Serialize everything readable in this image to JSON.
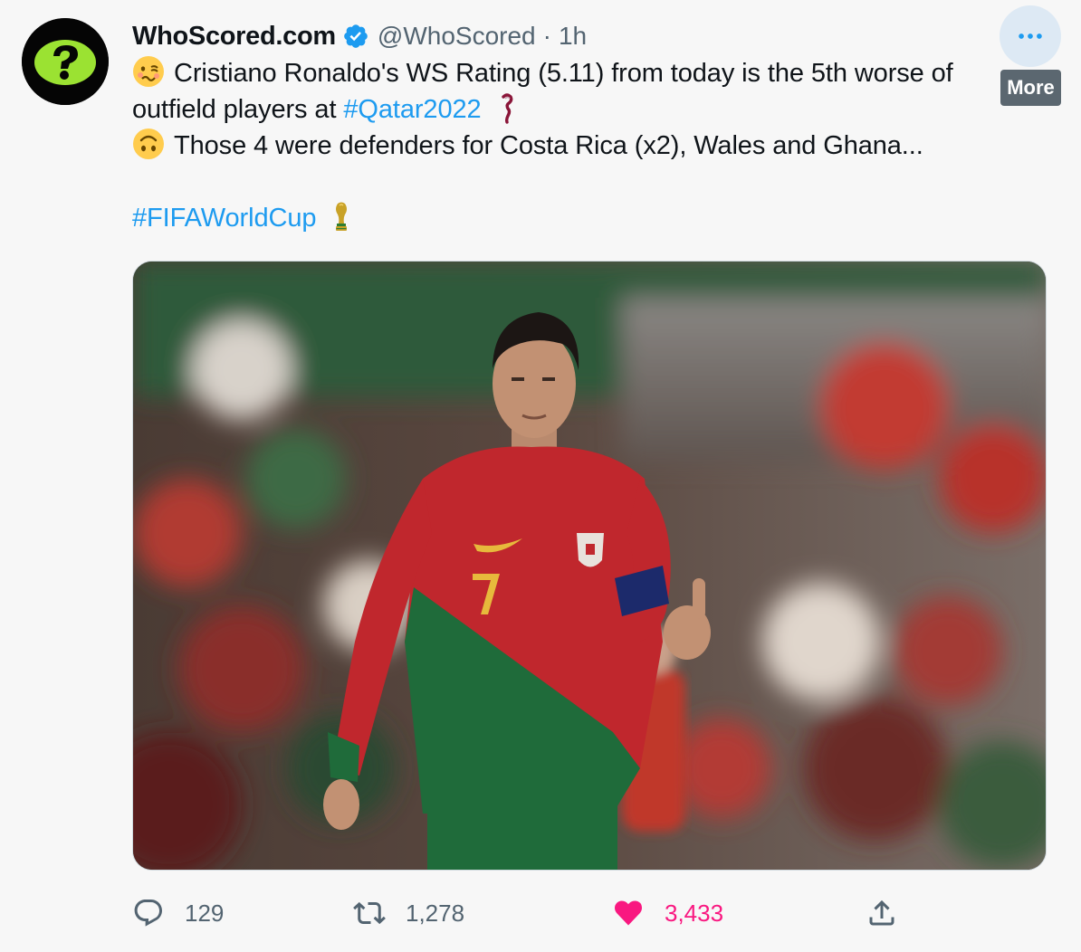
{
  "tweet": {
    "display_name": "WhoScored.com",
    "handle": "@WhoScored",
    "separator": "·",
    "time": "1h",
    "more_tooltip": "More",
    "body": {
      "line1": "Cristiano Ronaldo's WS Rating (5.11) from today is the 5th worse of",
      "line2_text": "outfield players at ",
      "line2_hashtag": "#Qatar2022",
      "line3": "Those 4 were defenders for Costa Rica (x2), Wales and Ghana...",
      "line4_hashtag": "#FIFAWorldCup"
    },
    "emojis": [
      "woozy-face-icon",
      "qatar-2022-emblem-icon",
      "upside-down-face-icon",
      "world-cup-trophy-icon"
    ],
    "actions": {
      "replies": "129",
      "retweets": "1,278",
      "likes": "3,433"
    }
  },
  "colors": {
    "link": "#1d9bf0",
    "verified": "#1d9bf0",
    "like": "#f91880",
    "secondary_text": "#536471",
    "avatar_logo": "#9be232"
  }
}
